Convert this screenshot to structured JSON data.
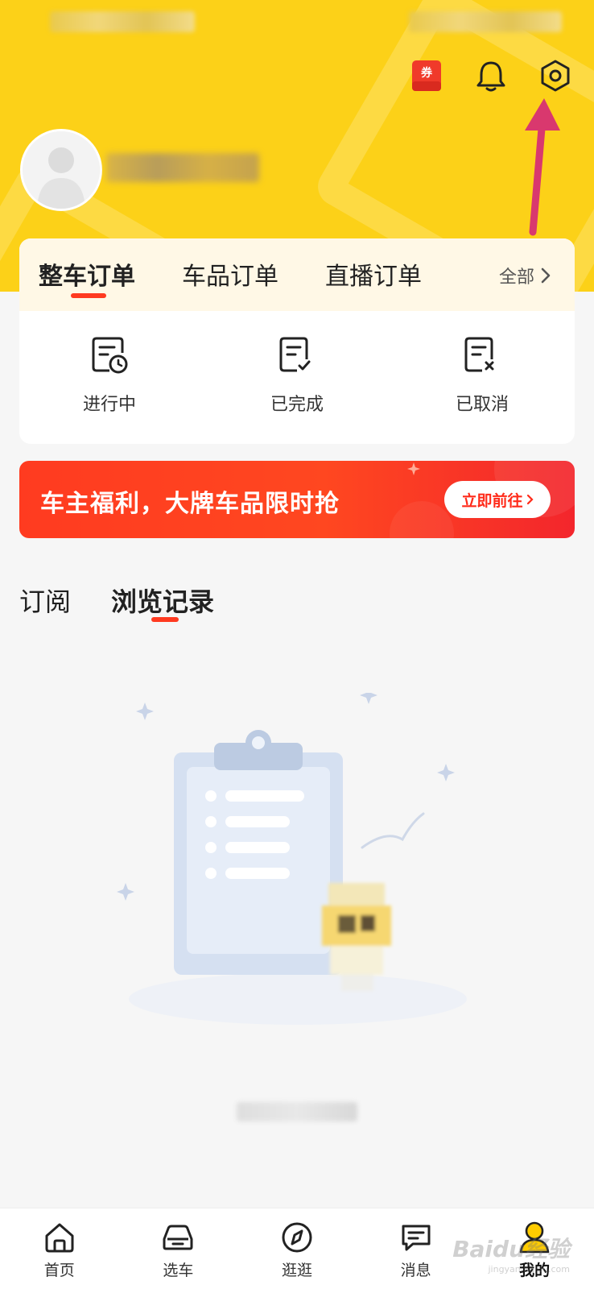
{
  "header": {
    "coupon_icon_text": "券",
    "icons": [
      "coupon-icon",
      "bell-icon",
      "settings-icon"
    ],
    "accent": "#fcd118"
  },
  "order_card": {
    "tabs": [
      {
        "label": "整车订单",
        "active": true
      },
      {
        "label": "车品订单",
        "active": false
      },
      {
        "label": "直播订单",
        "active": false
      }
    ],
    "all_label": "全部",
    "statuses": [
      {
        "label": "进行中",
        "icon": "order-pending-icon"
      },
      {
        "label": "已完成",
        "icon": "order-completed-icon"
      },
      {
        "label": "已取消",
        "icon": "order-cancelled-icon"
      }
    ]
  },
  "promo": {
    "text": "车主福利，大牌车品限时抢",
    "button_label": "立即前往"
  },
  "content_tabs": [
    {
      "label": "订阅",
      "active": false
    },
    {
      "label": "浏览记录",
      "active": true
    }
  ],
  "bottom_nav": [
    {
      "label": "首页",
      "icon": "home-icon",
      "active": false
    },
    {
      "label": "选车",
      "icon": "car-icon",
      "active": false
    },
    {
      "label": "逛逛",
      "icon": "compass-icon",
      "active": false
    },
    {
      "label": "消息",
      "icon": "message-icon",
      "active": false
    },
    {
      "label": "我的",
      "icon": "profile-icon",
      "active": true
    }
  ],
  "watermark": {
    "text": "Baidu经验",
    "sub": "jingyan.baidu.com"
  },
  "colors": {
    "accent_red": "#ff3a20",
    "header_yellow": "#fcd118"
  }
}
